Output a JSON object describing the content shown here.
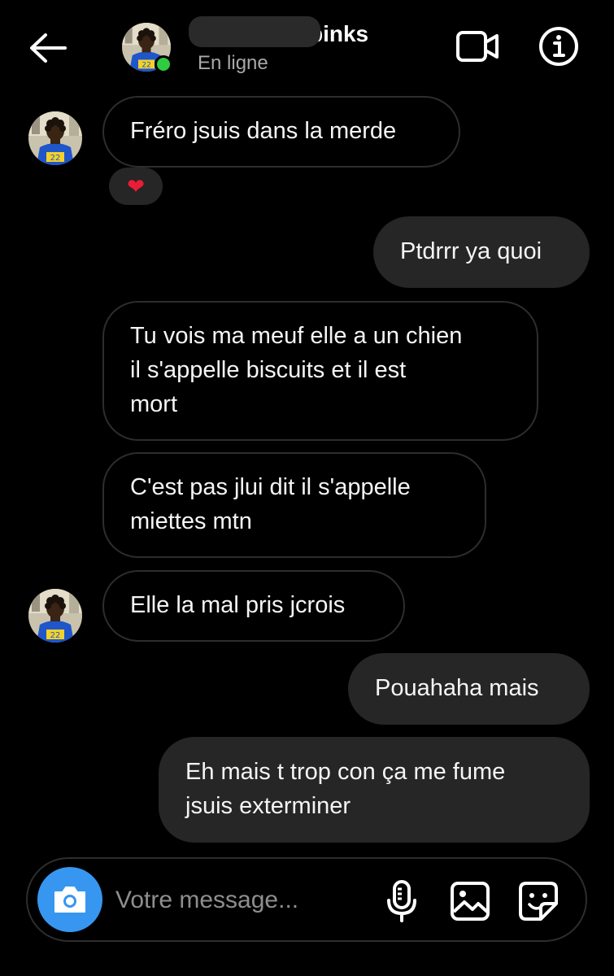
{
  "header": {
    "contact_name": "binks",
    "status": "En ligne"
  },
  "messages": [
    {
      "direction": "received",
      "text": "Fréro jsuis dans la merde",
      "reaction": "❤"
    },
    {
      "direction": "sent",
      "text": "Ptdrrr ya quoi"
    },
    {
      "direction": "received",
      "text": "Tu vois ma meuf elle a un chien\nil s'appelle biscuits et il est\nmort"
    },
    {
      "direction": "received",
      "text": "C'est pas jlui dit il s'appelle\nmiettes mtn"
    },
    {
      "direction": "received",
      "text": "Elle la mal pris jcrois"
    },
    {
      "direction": "sent",
      "text": "Pouahaha mais"
    },
    {
      "direction": "sent",
      "text": "Eh mais t trop con ça me fume\njsuis exterminer"
    }
  ],
  "composer": {
    "placeholder": "Votre message..."
  },
  "icons": {
    "back": "arrow-left-icon",
    "video": "video-camera-icon",
    "info": "info-icon",
    "camera": "camera-icon",
    "mic": "microphone-icon",
    "gallery": "image-icon",
    "sticker": "sticker-icon"
  },
  "colors": {
    "background": "#000000",
    "sent_bubble": "#262626",
    "received_border": "#2d2d2d",
    "online": "#2ecc40",
    "camera_button": "#3797f0",
    "heart": "#ed1c35"
  }
}
